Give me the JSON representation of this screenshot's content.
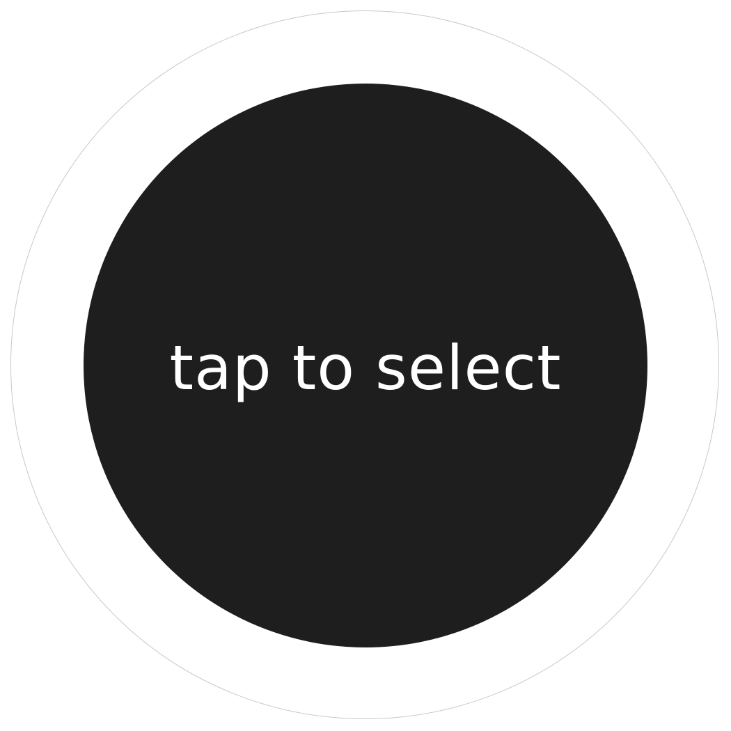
{
  "button": {
    "label": "tap to select"
  },
  "colors": {
    "button_fill": "#1e1e1e",
    "ring_stroke": "#c8c8c8",
    "label_color": "#ffffff"
  }
}
